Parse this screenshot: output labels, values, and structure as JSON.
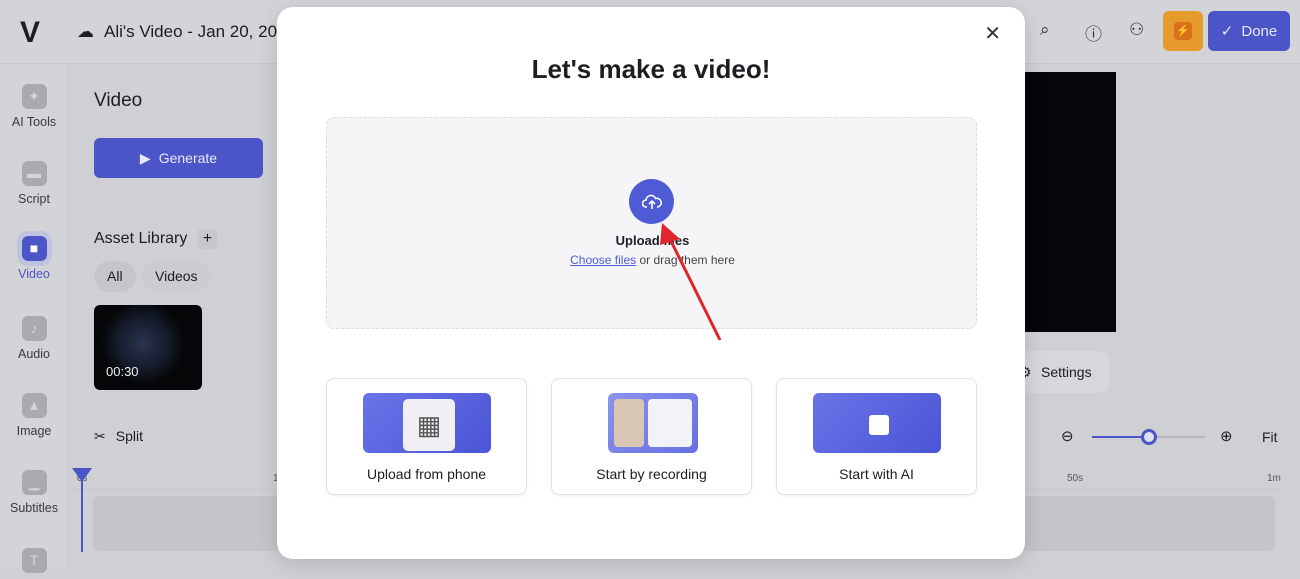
{
  "topbar": {
    "logo": "V",
    "project_title": "Ali's Video - Jan 20, 20",
    "done_label": "Done"
  },
  "rail": [
    {
      "label": "AI Tools",
      "icon": "sparkle-icon"
    },
    {
      "label": "Script",
      "icon": "script-icon"
    },
    {
      "label": "Video",
      "icon": "video-icon"
    },
    {
      "label": "Audio",
      "icon": "music-icon"
    },
    {
      "label": "Image",
      "icon": "image-icon"
    },
    {
      "label": "Subtitles",
      "icon": "subtitles-icon"
    },
    {
      "label": "Text",
      "icon": "text-icon"
    }
  ],
  "panel": {
    "title": "Video",
    "generate_label": "Generate",
    "asset_library": "Asset Library",
    "filters": [
      "All",
      "Videos"
    ],
    "asset_duration": "00:30"
  },
  "timeline": {
    "split_label": "Split",
    "fit_label": "Fit",
    "zoom_level": 0.5,
    "ruler": [
      "0s",
      "1",
      "50s",
      "1m"
    ]
  },
  "preview": {
    "settings_label": "Settings"
  },
  "modal": {
    "title": "Let's make a video!",
    "upload_title": "Upload files",
    "choose_files": "Choose files",
    "drag_text": " or drag them here",
    "options": [
      "Upload from phone",
      "Start by recording",
      "Start with AI"
    ]
  },
  "colors": {
    "accent": "#4f5bd5",
    "orange": "#e69a2c",
    "annotation": "#e0262b"
  }
}
